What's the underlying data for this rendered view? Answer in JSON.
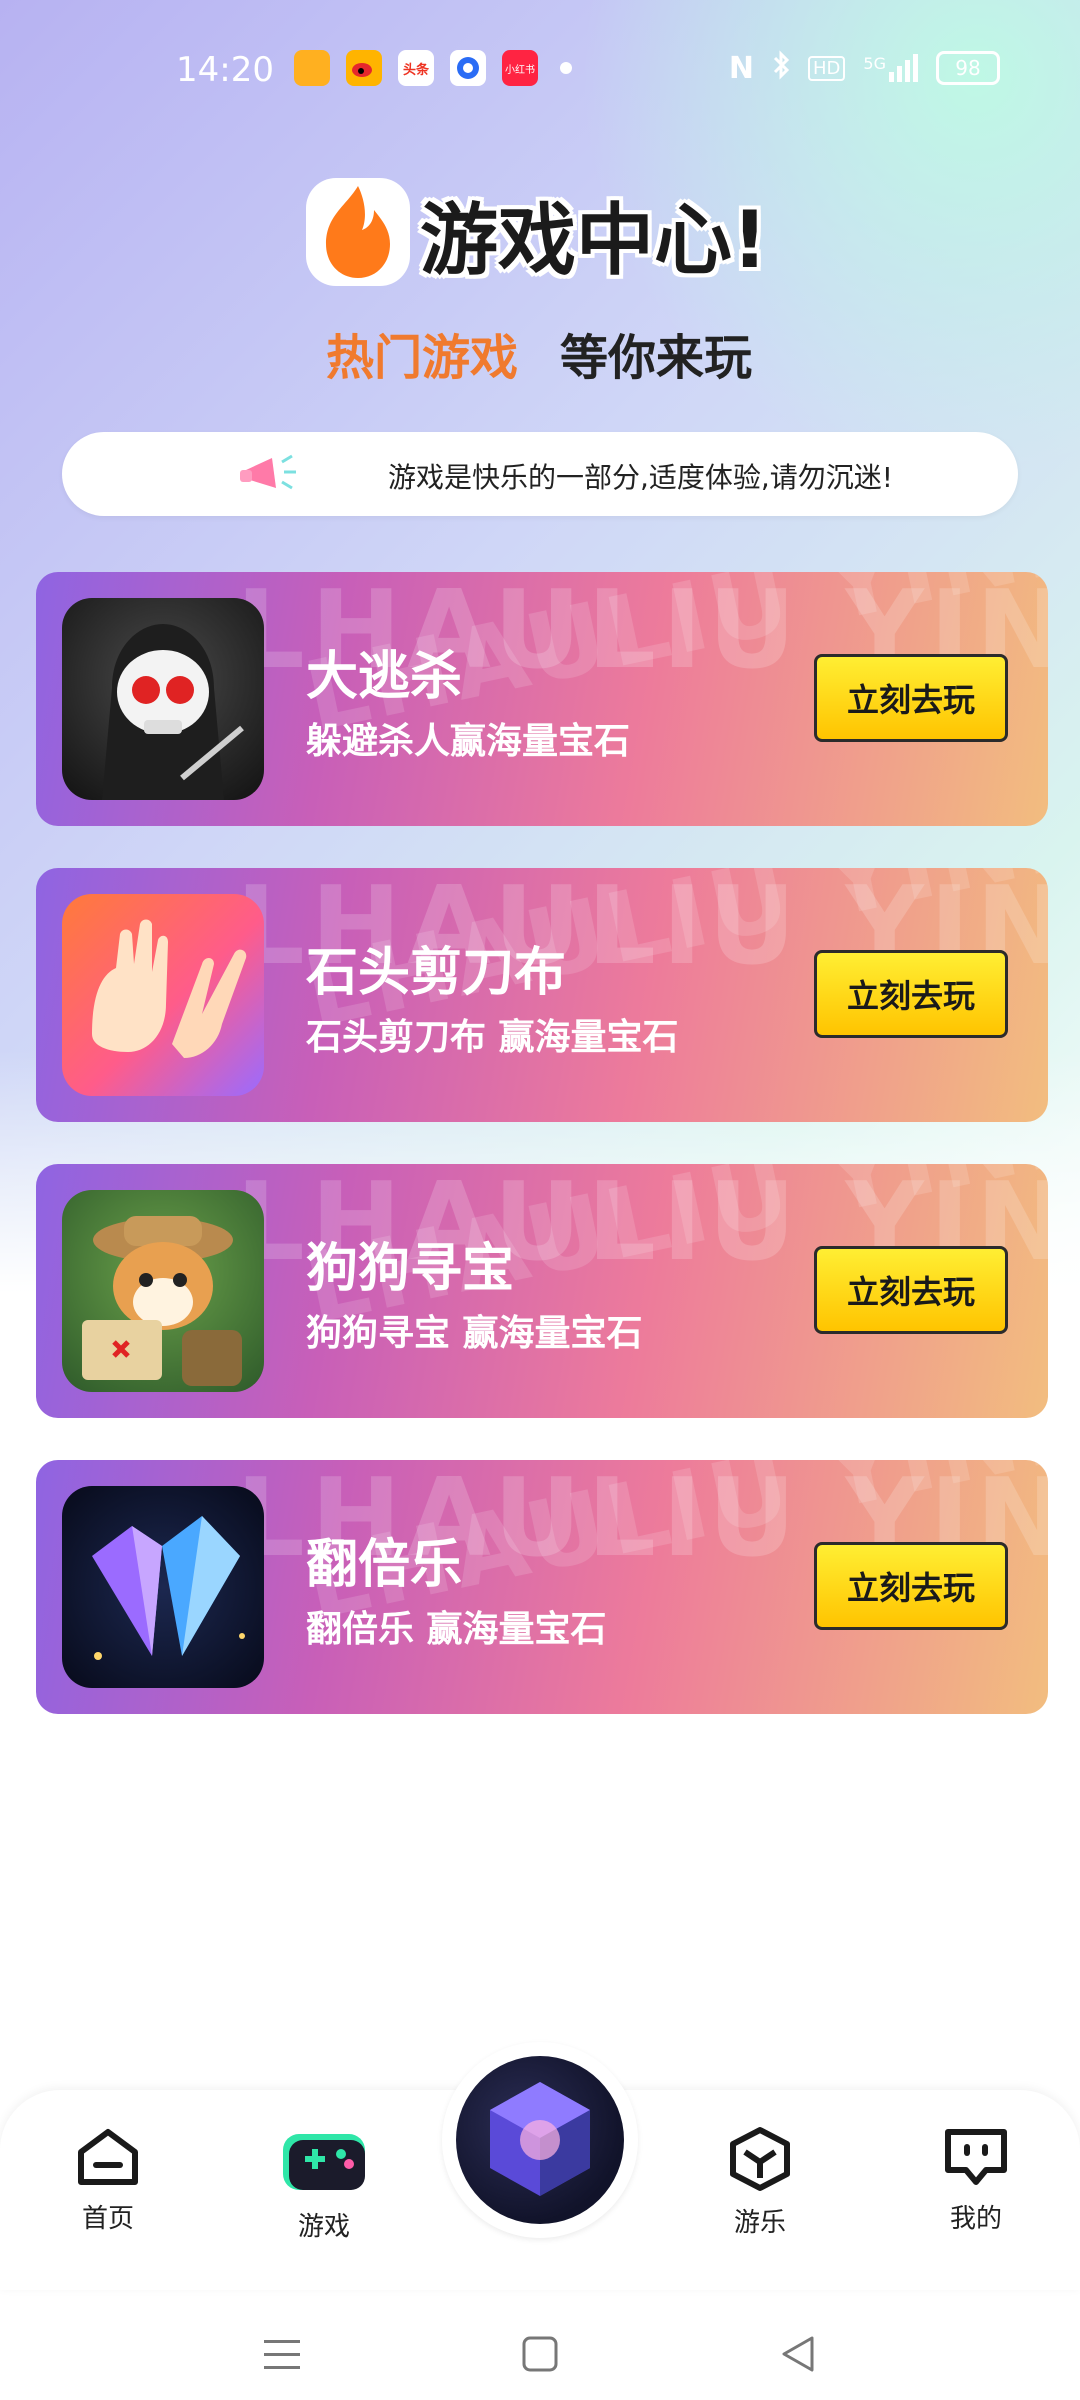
{
  "status_bar": {
    "time": "14:20",
    "notification_icons": [
      "app-icon-orange",
      "weibo-icon",
      "toutiao-icon",
      "blue-circle-app-icon",
      "xiaohongshu-icon"
    ],
    "notif_labels": [
      "",
      "",
      "头条",
      "",
      "小红书"
    ],
    "signal": "5G",
    "hd": "HD",
    "battery": "98"
  },
  "header": {
    "title": "游戏中心!",
    "subtitle_hot": "热门游戏",
    "subtitle_wait": "等你来玩"
  },
  "notice": {
    "text": "游戏是快乐的一部分,适度体验,请勿沉迷!"
  },
  "watermark_text": "LHAULIU YINLI",
  "games": [
    {
      "title": "大逃杀",
      "desc": "躲避杀人赢海量宝石",
      "button": "立刻去玩"
    },
    {
      "title": "石头剪刀布",
      "desc": "石头剪刀布 赢海量宝石",
      "button": "立刻去玩"
    },
    {
      "title": "狗狗寻宝",
      "desc": "狗狗寻宝 赢海量宝石",
      "button": "立刻去玩"
    },
    {
      "title": "翻倍乐",
      "desc": "翻倍乐 赢海量宝石",
      "button": "立刻去玩"
    }
  ],
  "nav": {
    "home": "首页",
    "games": "游戏",
    "fun": "游乐",
    "mine": "我的"
  },
  "colors": {
    "accent_orange": "#f07a2e",
    "button_yellow": "#ffd400",
    "card_start": "#8f64e2",
    "card_end": "#f2bd7f",
    "games_icon_green": "#2fe6a8"
  }
}
